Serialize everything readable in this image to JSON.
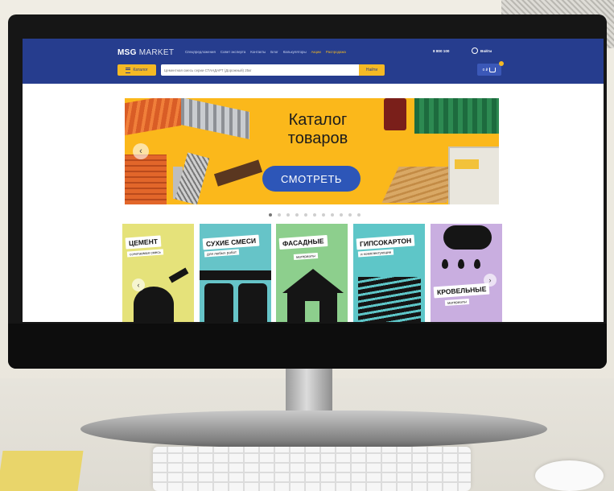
{
  "site": {
    "logo_bold": "MSG",
    "logo_thin": "MARKET",
    "nav": [
      "Спецпредложения",
      "Совет эксперта",
      "Контакты",
      "Блог",
      "Калькуляторы",
      "Акции",
      "Распродажа"
    ],
    "nav_accent_indexes": [
      5,
      6
    ],
    "phone": "8 800 100",
    "login_label": "Войти",
    "catalog_label": "Каталог",
    "search_placeholder": "Цементная смесь серии СТАНДАРТ (Дорожный) 25кг",
    "search_button": "Найти",
    "cart_label": "0 ₽"
  },
  "banner": {
    "title_line1": "Каталог",
    "title_line2": "товаров",
    "button_label": "СМОТРЕТЬ",
    "slides_count": 11,
    "active_slide": 0
  },
  "categories": [
    {
      "title": "ЦЕМЕНТ",
      "subtitle": "сочетаемая смесь",
      "color": "#e5e27a"
    },
    {
      "title": "СУХИЕ СМЕСИ",
      "subtitle": "для любых работ",
      "color": "#66c4c8"
    },
    {
      "title": "ФАСАДНЫЕ",
      "subtitle": "материалы",
      "color": "#8dcf8d"
    },
    {
      "title": "ГИПСОКАРТОН",
      "subtitle": "и комплектующие",
      "color": "#5ec6c8"
    },
    {
      "title": "КРОВЕЛЬНЫЕ",
      "subtitle": "материалы",
      "color": "#c9aee0"
    }
  ],
  "colors": {
    "header_bg": "#263d8e",
    "accent_yellow": "#f4b924",
    "banner_bg": "#fbb81b",
    "button_blue": "#2d56b8"
  },
  "icons": [
    "search-icon",
    "user-icon",
    "cart-icon",
    "burger-menu-icon",
    "arrow-left-icon",
    "arrow-right-icon"
  ]
}
